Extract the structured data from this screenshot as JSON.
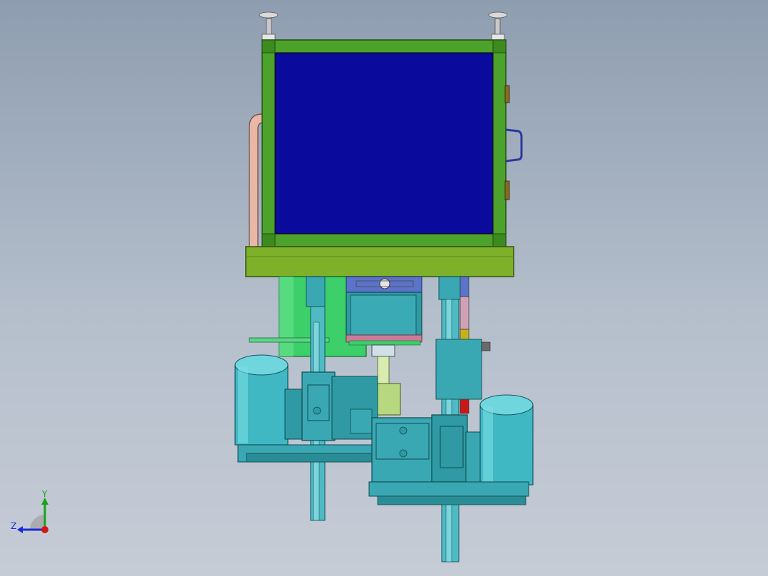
{
  "viewport": {
    "background_top": "#8e9db0",
    "background_bottom": "#c6ccd6"
  },
  "model": {
    "frame_color": "#4ca22a",
    "panel_color": "#0a0a9c",
    "base_plate_color": "#7fb02a",
    "motor_color": "#3fb8c4",
    "gearbox_color": "#2f9aa3",
    "green_cylinder_color": "#3ccf6a"
  },
  "triad": {
    "x_label": "",
    "y_label": "Y",
    "z_label": "Z",
    "x_color": "#d01818",
    "y_color": "#19a319",
    "z_color": "#1a2ad8"
  }
}
